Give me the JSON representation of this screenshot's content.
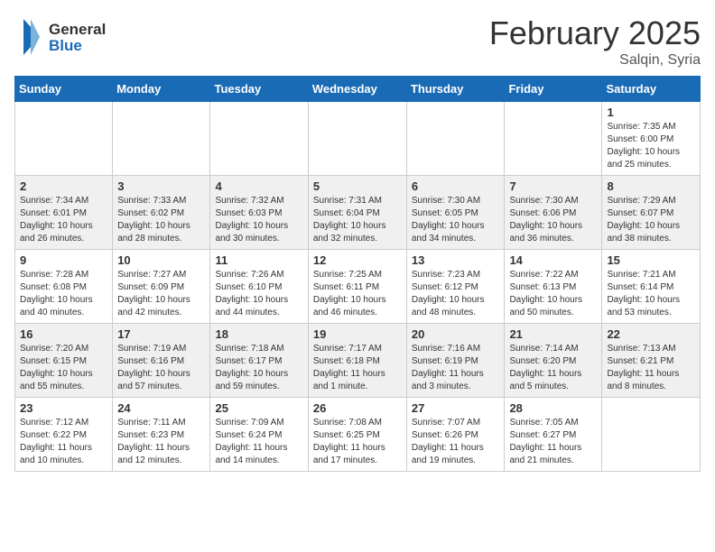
{
  "header": {
    "logo_line1": "General",
    "logo_line2": "Blue",
    "month": "February 2025",
    "location": "Salqin, Syria"
  },
  "weekdays": [
    "Sunday",
    "Monday",
    "Tuesday",
    "Wednesday",
    "Thursday",
    "Friday",
    "Saturday"
  ],
  "weeks": [
    [
      {
        "day": "",
        "info": ""
      },
      {
        "day": "",
        "info": ""
      },
      {
        "day": "",
        "info": ""
      },
      {
        "day": "",
        "info": ""
      },
      {
        "day": "",
        "info": ""
      },
      {
        "day": "",
        "info": ""
      },
      {
        "day": "1",
        "info": "Sunrise: 7:35 AM\nSunset: 6:00 PM\nDaylight: 10 hours and 25 minutes."
      }
    ],
    [
      {
        "day": "2",
        "info": "Sunrise: 7:34 AM\nSunset: 6:01 PM\nDaylight: 10 hours and 26 minutes."
      },
      {
        "day": "3",
        "info": "Sunrise: 7:33 AM\nSunset: 6:02 PM\nDaylight: 10 hours and 28 minutes."
      },
      {
        "day": "4",
        "info": "Sunrise: 7:32 AM\nSunset: 6:03 PM\nDaylight: 10 hours and 30 minutes."
      },
      {
        "day": "5",
        "info": "Sunrise: 7:31 AM\nSunset: 6:04 PM\nDaylight: 10 hours and 32 minutes."
      },
      {
        "day": "6",
        "info": "Sunrise: 7:30 AM\nSunset: 6:05 PM\nDaylight: 10 hours and 34 minutes."
      },
      {
        "day": "7",
        "info": "Sunrise: 7:30 AM\nSunset: 6:06 PM\nDaylight: 10 hours and 36 minutes."
      },
      {
        "day": "8",
        "info": "Sunrise: 7:29 AM\nSunset: 6:07 PM\nDaylight: 10 hours and 38 minutes."
      }
    ],
    [
      {
        "day": "9",
        "info": "Sunrise: 7:28 AM\nSunset: 6:08 PM\nDaylight: 10 hours and 40 minutes."
      },
      {
        "day": "10",
        "info": "Sunrise: 7:27 AM\nSunset: 6:09 PM\nDaylight: 10 hours and 42 minutes."
      },
      {
        "day": "11",
        "info": "Sunrise: 7:26 AM\nSunset: 6:10 PM\nDaylight: 10 hours and 44 minutes."
      },
      {
        "day": "12",
        "info": "Sunrise: 7:25 AM\nSunset: 6:11 PM\nDaylight: 10 hours and 46 minutes."
      },
      {
        "day": "13",
        "info": "Sunrise: 7:23 AM\nSunset: 6:12 PM\nDaylight: 10 hours and 48 minutes."
      },
      {
        "day": "14",
        "info": "Sunrise: 7:22 AM\nSunset: 6:13 PM\nDaylight: 10 hours and 50 minutes."
      },
      {
        "day": "15",
        "info": "Sunrise: 7:21 AM\nSunset: 6:14 PM\nDaylight: 10 hours and 53 minutes."
      }
    ],
    [
      {
        "day": "16",
        "info": "Sunrise: 7:20 AM\nSunset: 6:15 PM\nDaylight: 10 hours and 55 minutes."
      },
      {
        "day": "17",
        "info": "Sunrise: 7:19 AM\nSunset: 6:16 PM\nDaylight: 10 hours and 57 minutes."
      },
      {
        "day": "18",
        "info": "Sunrise: 7:18 AM\nSunset: 6:17 PM\nDaylight: 10 hours and 59 minutes."
      },
      {
        "day": "19",
        "info": "Sunrise: 7:17 AM\nSunset: 6:18 PM\nDaylight: 11 hours and 1 minute."
      },
      {
        "day": "20",
        "info": "Sunrise: 7:16 AM\nSunset: 6:19 PM\nDaylight: 11 hours and 3 minutes."
      },
      {
        "day": "21",
        "info": "Sunrise: 7:14 AM\nSunset: 6:20 PM\nDaylight: 11 hours and 5 minutes."
      },
      {
        "day": "22",
        "info": "Sunrise: 7:13 AM\nSunset: 6:21 PM\nDaylight: 11 hours and 8 minutes."
      }
    ],
    [
      {
        "day": "23",
        "info": "Sunrise: 7:12 AM\nSunset: 6:22 PM\nDaylight: 11 hours and 10 minutes."
      },
      {
        "day": "24",
        "info": "Sunrise: 7:11 AM\nSunset: 6:23 PM\nDaylight: 11 hours and 12 minutes."
      },
      {
        "day": "25",
        "info": "Sunrise: 7:09 AM\nSunset: 6:24 PM\nDaylight: 11 hours and 14 minutes."
      },
      {
        "day": "26",
        "info": "Sunrise: 7:08 AM\nSunset: 6:25 PM\nDaylight: 11 hours and 17 minutes."
      },
      {
        "day": "27",
        "info": "Sunrise: 7:07 AM\nSunset: 6:26 PM\nDaylight: 11 hours and 19 minutes."
      },
      {
        "day": "28",
        "info": "Sunrise: 7:05 AM\nSunset: 6:27 PM\nDaylight: 11 hours and 21 minutes."
      },
      {
        "day": "",
        "info": ""
      }
    ]
  ]
}
